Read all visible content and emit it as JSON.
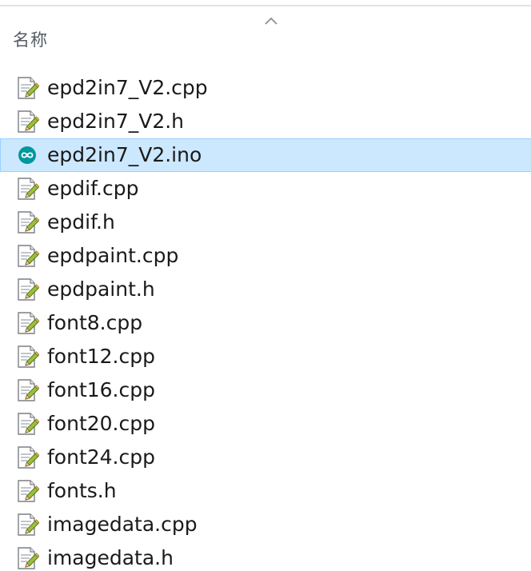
{
  "header": {
    "name_label": "名称"
  },
  "files": [
    {
      "name": "epd2in7_V2.cpp",
      "icon": "text-file-pencil-icon",
      "selected": false
    },
    {
      "name": "epd2in7_V2.h",
      "icon": "text-file-pencil-icon",
      "selected": false
    },
    {
      "name": "epd2in7_V2.ino",
      "icon": "arduino-icon",
      "selected": true
    },
    {
      "name": "epdif.cpp",
      "icon": "text-file-pencil-icon",
      "selected": false
    },
    {
      "name": "epdif.h",
      "icon": "text-file-pencil-icon",
      "selected": false
    },
    {
      "name": "epdpaint.cpp",
      "icon": "text-file-pencil-icon",
      "selected": false
    },
    {
      "name": "epdpaint.h",
      "icon": "text-file-pencil-icon",
      "selected": false
    },
    {
      "name": "font8.cpp",
      "icon": "text-file-pencil-icon",
      "selected": false
    },
    {
      "name": "font12.cpp",
      "icon": "text-file-pencil-icon",
      "selected": false
    },
    {
      "name": "font16.cpp",
      "icon": "text-file-pencil-icon",
      "selected": false
    },
    {
      "name": "font20.cpp",
      "icon": "text-file-pencil-icon",
      "selected": false
    },
    {
      "name": "font24.cpp",
      "icon": "text-file-pencil-icon",
      "selected": false
    },
    {
      "name": "fonts.h",
      "icon": "text-file-pencil-icon",
      "selected": false
    },
    {
      "name": "imagedata.cpp",
      "icon": "text-file-pencil-icon",
      "selected": false
    },
    {
      "name": "imagedata.h",
      "icon": "text-file-pencil-icon",
      "selected": false
    }
  ],
  "colors": {
    "selection_bg": "#cce8ff",
    "selection_border": "#99d1ff",
    "arduino": "#00979d"
  }
}
